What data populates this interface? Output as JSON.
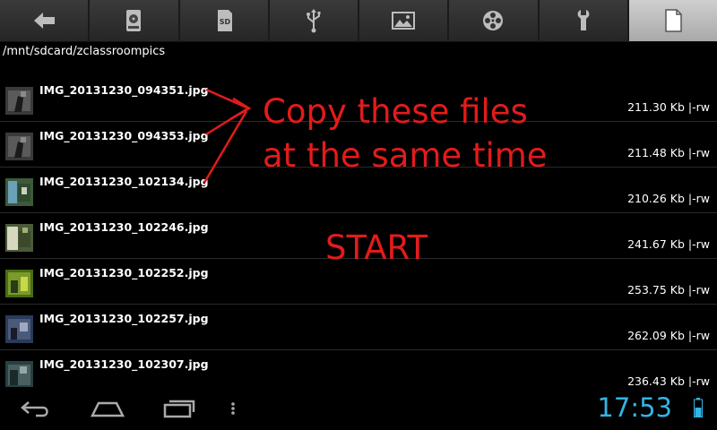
{
  "toolbar": {
    "buttons": [
      {
        "icon": "back-arrow-icon"
      },
      {
        "icon": "internal-storage-icon"
      },
      {
        "icon": "sd-card-icon",
        "label": "SD"
      },
      {
        "icon": "usb-icon"
      },
      {
        "icon": "image-icon"
      },
      {
        "icon": "video-reel-icon"
      },
      {
        "icon": "wrench-icon"
      },
      {
        "icon": "document-icon",
        "active": true
      }
    ]
  },
  "path": "/mnt/sdcard/zclassroompics",
  "files": [
    {
      "name": "IMG_20131230_094351.jpg",
      "size": "211.30 Kb",
      "perm": "|-rw"
    },
    {
      "name": "IMG_20131230_094353.jpg",
      "size": "211.48 Kb",
      "perm": "|-rw"
    },
    {
      "name": "IMG_20131230_102134.jpg",
      "size": "210.26 Kb",
      "perm": "|-rw"
    },
    {
      "name": "IMG_20131230_102246.jpg",
      "size": "241.67 Kb",
      "perm": "|-rw"
    },
    {
      "name": "IMG_20131230_102252.jpg",
      "size": "253.75 Kb",
      "perm": "|-rw"
    },
    {
      "name": "IMG_20131230_102257.jpg",
      "size": "262.09 Kb",
      "perm": "|-rw"
    },
    {
      "name": "IMG_20131230_102307.jpg",
      "size": "236.43 Kb",
      "perm": "|-rw"
    }
  ],
  "annotations": {
    "line1": "Copy these files",
    "line2": "at the same time",
    "start": "START",
    "color": "#e31b1b"
  },
  "statusbar": {
    "time": "17:53",
    "accent": "#33b5e5"
  }
}
